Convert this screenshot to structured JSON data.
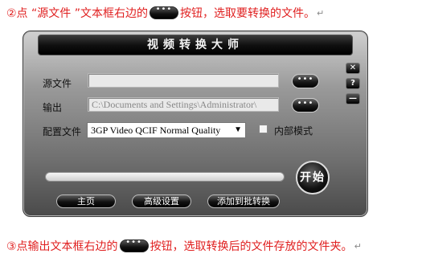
{
  "doc": {
    "line1_prefix": "②点 “源文件 ”文本框右边的",
    "line1_suffix": "按钮，选取要转换的文件。",
    "line3_prefix": "③点输出文本框右边的",
    "line3_suffix": "按钮，选取转换后的文件存放的文件夹。",
    "para_mark": "↵"
  },
  "window": {
    "title": "视频转换大师",
    "source_label": "源文件",
    "source_value": "",
    "output_label": "输出",
    "output_value": "C:\\Documents and Settings\\Administrator\\",
    "browse_label": "•••",
    "config_label": "配置文件",
    "config_selected": "3GP Video QCIF Normal Quality",
    "internal_mode_label": "内部模式",
    "internal_mode_checked": false,
    "progress": 0,
    "start_label": "开始",
    "home_label": "主页",
    "advanced_label": "高级设置",
    "batch_label": "添加到批转换",
    "close_glyph": "✕",
    "help_glyph": "?",
    "minimize_glyph": "—"
  },
  "colors": {
    "instruction_text": "#e02020"
  }
}
